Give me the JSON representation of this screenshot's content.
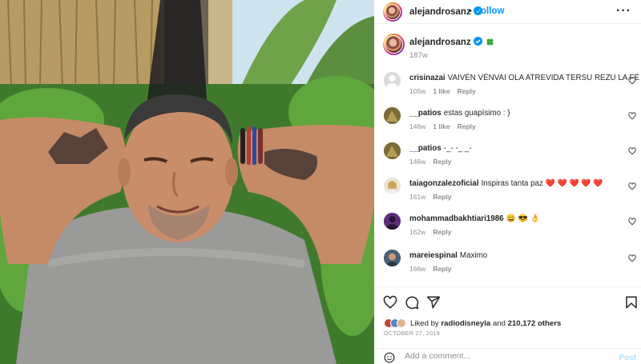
{
  "post": {
    "author": "alejandrosanz",
    "follow_label": "Follow",
    "dot": "•",
    "more_label": "···"
  },
  "caption": {
    "author": "alejandrosanz",
    "time": "187w"
  },
  "comments": [
    {
      "user": "crisinazai",
      "text": "VAIVÉN VÉNVAI OLA ATREVIDA TERSU REZU LA FÉ",
      "time": "105w",
      "likes": "1 like",
      "reply": "Reply"
    },
    {
      "user": "__patios",
      "text": "estas guapísimo : )",
      "time": "146w",
      "likes": "1 like",
      "reply": "Reply"
    },
    {
      "user": "__patios",
      "text": "-_- -_ _-",
      "time": "146w",
      "likes": "",
      "reply": "Reply"
    },
    {
      "user": "taiagonzalezoficial",
      "text": "Inspiras tanta paz ❤️ ❤️ ❤️ ❤️ ❤️",
      "time": "161w",
      "likes": "",
      "reply": "Reply"
    },
    {
      "user": "mohammadbakhtiari1986",
      "text": "😄 😎 👌",
      "time": "162w",
      "likes": "",
      "reply": "Reply"
    },
    {
      "user": "mareiespinal",
      "text": "Maximo",
      "time": "166w",
      "likes": "",
      "reply": "Reply"
    }
  ],
  "likes": {
    "prefix": "Liked by",
    "user": "radiodisneyla",
    "and": "and",
    "count": "210,172 others"
  },
  "date": "OCTOBER 27, 2019",
  "add_comment": {
    "placeholder": "Add a comment...",
    "post_label": "Post"
  },
  "icons": {
    "header": [
      "verified-badge-icon",
      "more-options-icon"
    ],
    "actions": [
      "heart-icon",
      "comment-icon",
      "share-icon",
      "save-icon"
    ],
    "emoji": "emoji-icon"
  },
  "colors": {
    "link": "#0095f6",
    "muted": "#8e8e8e",
    "post_disabled": "#b2dffc",
    "heart_red": "#ed4956"
  }
}
